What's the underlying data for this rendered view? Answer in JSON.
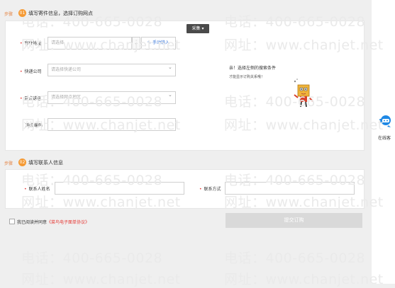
{
  "step1": {
    "step_prefix": "步骤",
    "step_number": "01",
    "title": "填写寄件信息，选择订购网点",
    "collect_button": "采集 ▾",
    "fields": {
      "address_label": "寄件地址",
      "address_placeholder": "请选择",
      "manual_input_label": "手动输入",
      "courier_label": "快递公司",
      "courier_placeholder": "请选择快递公司",
      "branch_label": "网点选区",
      "branch_placeholder": "请选择网点地区",
      "branch_code_label": "网点编码"
    },
    "empty_state": {
      "line1": "亲！选择左侧的搜索条件",
      "line2": "才能显示订购关系哦！"
    }
  },
  "step2": {
    "step_prefix": "步骤",
    "step_number": "02",
    "title": "填写联系人信息",
    "name_label": "联系人姓名",
    "contact_label": "联系方式"
  },
  "agreement": {
    "prefix": "我已阅读并同意",
    "link": "《菜鸟电子面单协议》"
  },
  "submit_label": "提交订购",
  "online_service_label": "在线客",
  "watermark": {
    "phone": "电话：400-665-0028",
    "site": "网址：www.chanjet.net"
  },
  "colors": {
    "accent_orange": "#f59a34",
    "link_red": "#e53935",
    "service_blue": "#1e88e5"
  }
}
